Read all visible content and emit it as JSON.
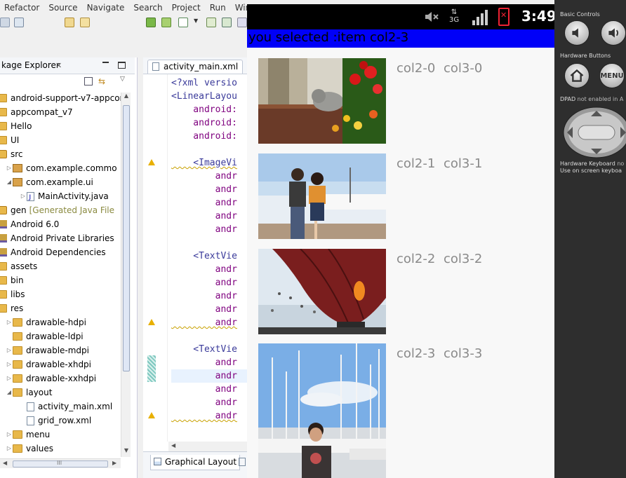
{
  "eclipse": {
    "menu": [
      "Refactor",
      "Source",
      "Navigate",
      "Search",
      "Project",
      "Run",
      "Win"
    ],
    "package_explorer": {
      "tab_label": "kage Explorer",
      "tree": [
        {
          "label": "android-support-v7-appcon",
          "icon": "project-icon",
          "indent": 0
        },
        {
          "label": "appcompat_v7",
          "icon": "project-icon",
          "indent": 0
        },
        {
          "label": "Hello",
          "icon": "project-icon",
          "indent": 0
        },
        {
          "label": "UI",
          "icon": "project-icon",
          "indent": 0
        },
        {
          "label": "src",
          "icon": "src-folder-icon",
          "indent": 0
        },
        {
          "label": "com.example.commo",
          "icon": "package-icon",
          "indent": 1,
          "arrow": "▷"
        },
        {
          "label": "com.example.ui",
          "icon": "package-icon",
          "indent": 1,
          "arrow": "◢"
        },
        {
          "label": "MainActivity.java",
          "icon": "java-file-icon",
          "indent": 2,
          "arrow": "▷"
        },
        {
          "label": "gen",
          "suffix": "[Generated Java File",
          "icon": "src-folder-icon",
          "indent": 0
        },
        {
          "label": "Android 6.0",
          "icon": "library-icon",
          "indent": 0
        },
        {
          "label": "Android Private Libraries",
          "icon": "library-icon",
          "indent": 0
        },
        {
          "label": "Android Dependencies",
          "icon": "library-icon",
          "indent": 0
        },
        {
          "label": "assets",
          "icon": "folder-icon",
          "indent": 0
        },
        {
          "label": "bin",
          "icon": "folder-icon",
          "indent": 0
        },
        {
          "label": "libs",
          "icon": "folder-icon",
          "indent": 0
        },
        {
          "label": "res",
          "icon": "folder-icon",
          "indent": 0
        },
        {
          "label": "drawable-hdpi",
          "icon": "folder-icon",
          "indent": 1,
          "arrow": "▷"
        },
        {
          "label": "drawable-ldpi",
          "icon": "folder-icon",
          "indent": 1
        },
        {
          "label": "drawable-mdpi",
          "icon": "folder-icon",
          "indent": 1,
          "arrow": "▷"
        },
        {
          "label": "drawable-xhdpi",
          "icon": "folder-icon",
          "indent": 1,
          "arrow": "▷"
        },
        {
          "label": "drawable-xxhdpi",
          "icon": "folder-icon",
          "indent": 1,
          "arrow": "▷"
        },
        {
          "label": "layout",
          "icon": "folder-icon",
          "indent": 1,
          "arrow": "◢"
        },
        {
          "label": "activity_main.xml",
          "icon": "xml-file-icon",
          "indent": 2
        },
        {
          "label": "grid_row.xml",
          "icon": "xml-file-icon",
          "indent": 2
        },
        {
          "label": "menu",
          "icon": "folder-icon",
          "indent": 1,
          "arrow": "▷"
        },
        {
          "label": "values",
          "icon": "folder-icon",
          "indent": 1,
          "arrow": "▷"
        }
      ],
      "hscroll_label": "III"
    },
    "editor": {
      "tab_label": "activity_main.xml",
      "bottom_tab_label": "Graphical Layout",
      "lines": [
        {
          "text": "<?xml versio",
          "kind": "tag"
        },
        {
          "text": "<LinearLayou",
          "kind": "tag"
        },
        {
          "text": "    android:",
          "kind": "attr"
        },
        {
          "text": "    android:",
          "kind": "attr"
        },
        {
          "text": "    android:",
          "kind": "attr"
        },
        {
          "text": "",
          "kind": "tag"
        },
        {
          "text": "    <ImageVi",
          "kind": "tag",
          "squiggle": true
        },
        {
          "text": "        andr",
          "kind": "attr"
        },
        {
          "text": "        andr",
          "kind": "attr"
        },
        {
          "text": "        andr",
          "kind": "attr"
        },
        {
          "text": "        andr",
          "kind": "attr"
        },
        {
          "text": "        andr",
          "kind": "attr"
        },
        {
          "text": "",
          "kind": "tag"
        },
        {
          "text": "    <TextVie",
          "kind": "tag"
        },
        {
          "text": "        andr",
          "kind": "attr"
        },
        {
          "text": "        andr",
          "kind": "attr"
        },
        {
          "text": "        andr",
          "kind": "attr"
        },
        {
          "text": "        andr",
          "kind": "attr"
        },
        {
          "text": "        andr",
          "kind": "attr",
          "squiggle": true
        },
        {
          "text": "",
          "kind": "tag"
        },
        {
          "text": "    <TextVie",
          "kind": "tag"
        },
        {
          "text": "        andr",
          "kind": "attr"
        },
        {
          "text": "        andr",
          "kind": "attr"
        },
        {
          "text": "        andr",
          "kind": "attr"
        },
        {
          "text": "        andr",
          "kind": "attr"
        },
        {
          "text": "        andr",
          "kind": "attr",
          "squiggle": true
        }
      ]
    }
  },
  "android": {
    "status_bar": {
      "time": "3:49",
      "network": "3G"
    },
    "title": "you selected :item col2-3",
    "title_bg": "#0000f8",
    "rows": [
      {
        "col2": "col2-0",
        "col3": "col3-0",
        "image": "cat-and-flowers-photo"
      },
      {
        "col2": "col2-1",
        "col3": "col3-1",
        "image": "couple-at-harbor-photo"
      },
      {
        "col2": "col2-2",
        "col3": "col3-2",
        "image": "hot-air-balloon-photo"
      },
      {
        "col2": "col2-3",
        "col3": "col3-3",
        "image": "man-at-marina-photo"
      }
    ]
  },
  "emulator_controls": {
    "basic_controls": "Basic Controls",
    "hardware_buttons": "Hardware Buttons",
    "home_icon": "home-icon",
    "menu_label": "MENU",
    "dpad_label": "DPAD",
    "dpad_note": "not enabled in A",
    "keyboard_label": "Hardware Keyboard",
    "keyboard_note": "no",
    "keyboard_hint": "Use on screen keyboa"
  }
}
